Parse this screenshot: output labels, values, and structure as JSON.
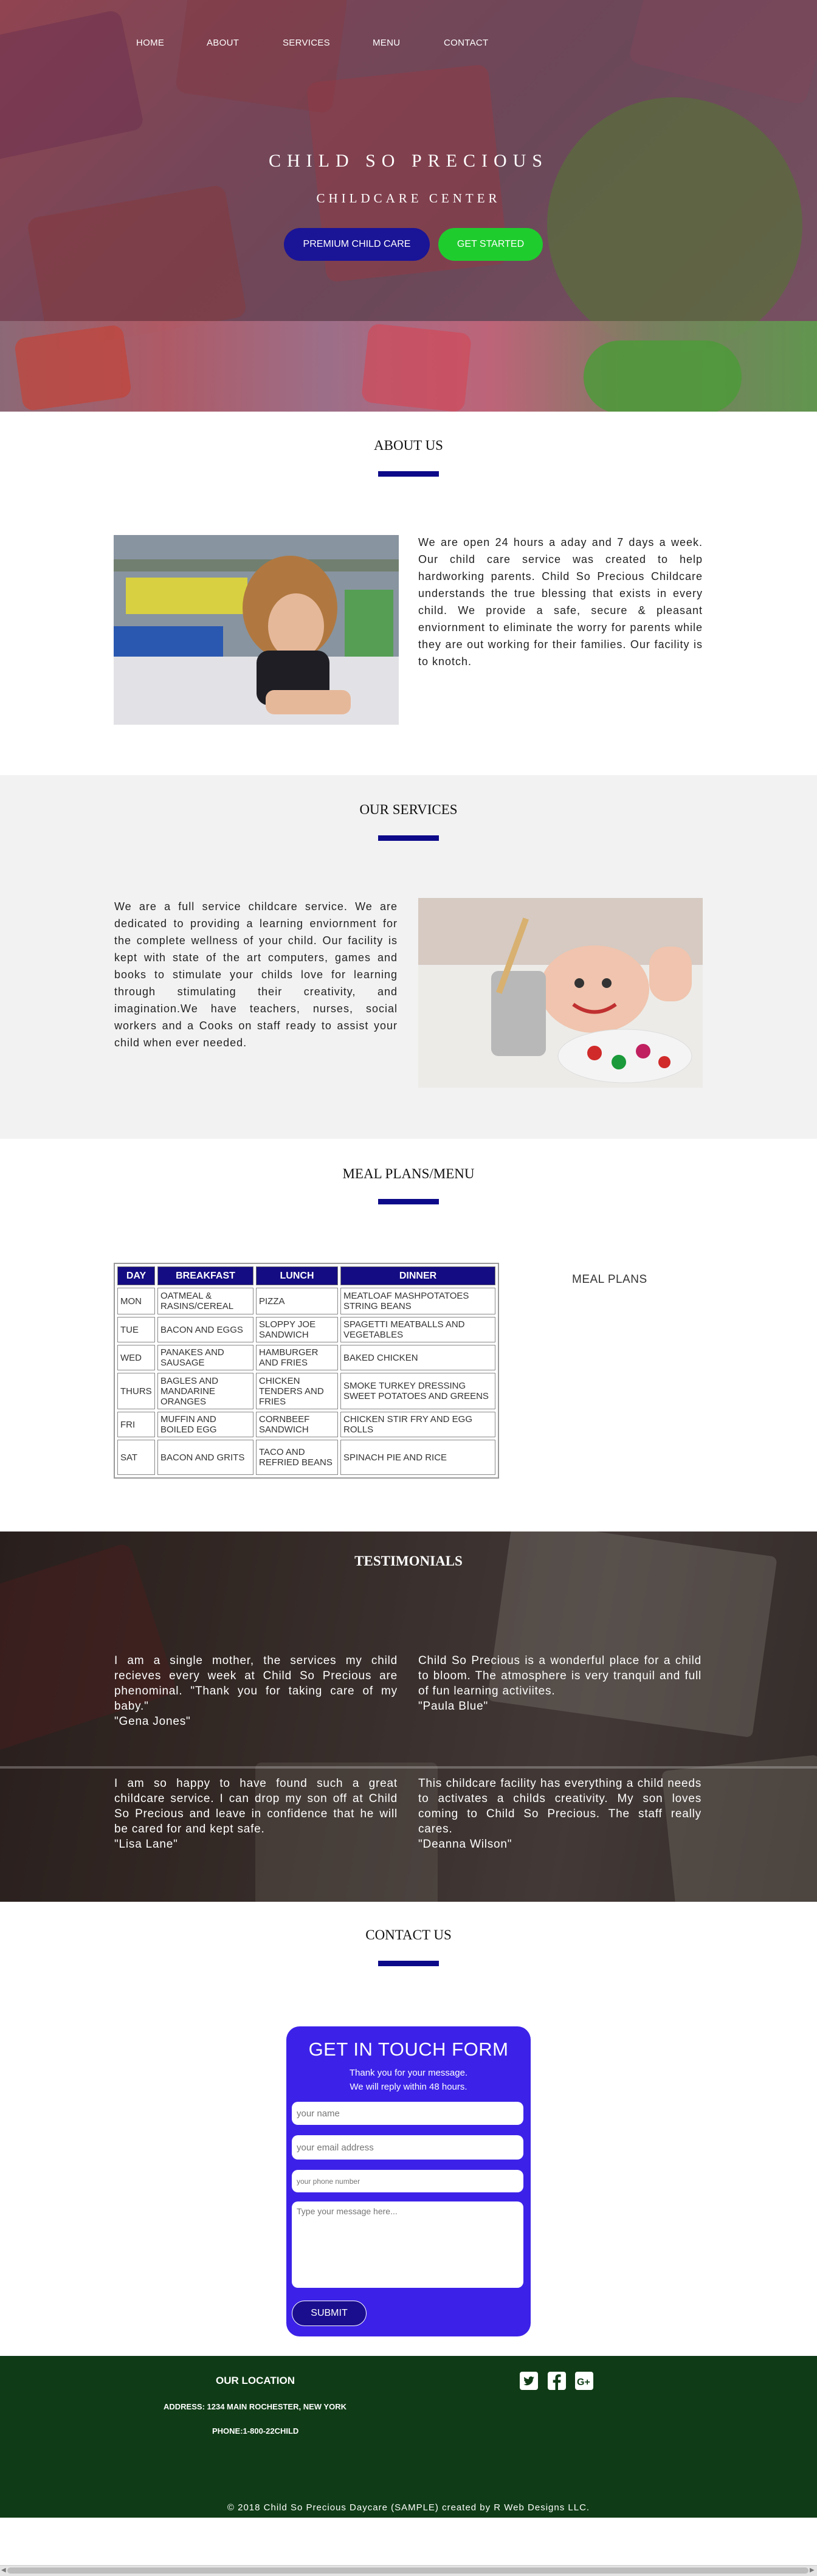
{
  "nav": {
    "items": [
      {
        "label": "HOME"
      },
      {
        "label": "ABOUT"
      },
      {
        "label": "SERVICES"
      },
      {
        "label": "MENU"
      },
      {
        "label": "CONTACT"
      }
    ]
  },
  "hero": {
    "title": "CHILD SO PRECIOUS",
    "subtitle": "CHILDCARE CENTER",
    "button_premium": "PREMIUM CHILD CARE",
    "button_start": "GET STARTED"
  },
  "about": {
    "heading": "ABOUT US",
    "text": "We are open 24 hours a aday and 7 days a week. Our child care service was created to help hardworking parents. Child So Precious Childcare understands the true blessing that exists in every child. We provide a safe, secure & pleasant enviornment to eliminate the worry for parents while they are out working for their families. Our facility is to knotch."
  },
  "services": {
    "heading": "OUR SERVICES",
    "text": "We are a full service childcare service. We are dedicated to providing a learning enviornment for the complete wellness of your child. Our facility is kept with state of the art computers, games and books to stimulate your childs love for learning through stimulating their creativity, and imagination.We have teachers, nurses, social workers and a Cooks on staff ready to assist your child when ever needed."
  },
  "menu": {
    "heading": "MEAL PLANS/MENU",
    "side_label": "MEAL PLANS",
    "columns": [
      "DAY",
      "BREAKFAST",
      "LUNCH",
      "DINNER"
    ],
    "rows": [
      [
        "MON",
        "OATMEAL & RASINS/CEREAL",
        "PIZZA",
        "MEATLOAF MASHPOTATOES STRING BEANS"
      ],
      [
        "TUE",
        "BACON AND EGGS",
        "SLOPPY JOE SANDWICH",
        "SPAGETTI MEATBALLS AND VEGETABLES"
      ],
      [
        "WED",
        "PANAKES AND SAUSAGE",
        "HAMBURGER AND FRIES",
        "BAKED CHICKEN"
      ],
      [
        "THURS",
        "BAGLES AND MANDARINE ORANGES",
        "CHICKEN TENDERS AND FRIES",
        "SMOKE TURKEY DRESSING SWEET POTATOES AND GREENS"
      ],
      [
        "FRI",
        "MUFFIN AND BOILED EGG",
        "CORNBEEF SANDWICH",
        "CHICKEN STIR FRY AND EGG ROLLS"
      ],
      [
        "SAT",
        "BACON AND GRITS",
        "TACO AND REFRIED BEANS",
        "SPINACH PIE AND RICE"
      ]
    ]
  },
  "testimonials": {
    "heading": "TESTIMONIALS",
    "items": [
      {
        "text": "I am a single mother, the services my child recieves every week at Child So Precious are phenominal. \"Thank you for taking care of my baby.\"",
        "author": "\"Gena Jones\""
      },
      {
        "text": "Child So Precious is a wonderful place for a child to bloom. The atmosphere is very tranquil and full of fun learning activiites.",
        "author": "\"Paula Blue\""
      },
      {
        "text": "I am so happy to have found such a great childcare service. I can drop my son off at Child So Precious and leave in confidence that he will be cared for and kept safe.",
        "author": "\"Lisa Lane\""
      },
      {
        "text": "This childcare facility has everything a child needs to activates a childs creativity. My son loves coming to Child So Precious. The staff really cares.",
        "author": "\"Deanna Wilson\""
      }
    ]
  },
  "contact": {
    "heading": "CONTACT US",
    "form_title": "GET IN TOUCH FORM",
    "thanks": "Thank you for your message.",
    "reply": "We will reply within 48 hours.",
    "name_placeholder": "your name",
    "email_placeholder": "your email address",
    "phone_placeholder": "your phone number",
    "message_placeholder": "Type your message here...",
    "submit": "SUBMIT"
  },
  "footer": {
    "location_heading": "OUR LOCATION",
    "address": "ADDRESS: 1234 MAIN ROCHESTER, NEW YORK",
    "phone": "PHONE:1-800-22CHILD",
    "social": [
      "twitter-icon",
      "facebook-icon",
      "google-plus-icon"
    ],
    "copyright": "© 2018 Child So Precious Daycare (SAMPLE) created by R Web Designs LLC."
  },
  "colors": {
    "navy": "#0d0a8a",
    "green_button": "#1fcc2e",
    "form_purple": "#3c22e8",
    "footer_green": "#0f3c16"
  }
}
